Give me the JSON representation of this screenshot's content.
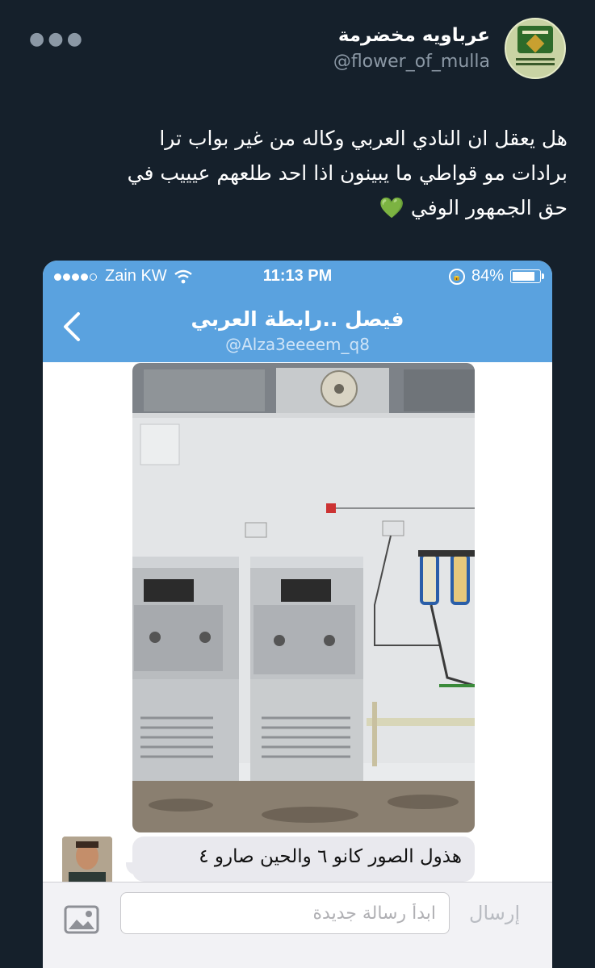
{
  "tweet": {
    "display_name": "عرباويه مخضرمة",
    "handle": "@flower_of_mulla",
    "text_lines": [
      "هل يعقل ان النادي العربي وكاله من غير بواب ترا",
      "برادات  مو قواطي ما يبينون اذا احد طلعهم عيييب في",
      "حق الجمهور الوفي"
    ],
    "emoji": "💚",
    "more_icon": "more-dots-icon"
  },
  "screenshot": {
    "status_bar": {
      "carrier": "Zain KW",
      "time": "11:13 PM",
      "battery": "84%"
    },
    "nav": {
      "title": "فيصل ..رابطة العربي",
      "subtitle": "@Alza3eeeem_q8"
    },
    "message": {
      "text": "هذول الصور كانو ٦ والحين صارو ٤"
    },
    "composer": {
      "placeholder": "ابدأ رسالة جديدة",
      "send_label": "إرسال"
    }
  },
  "colors": {
    "background": "#15202b",
    "ios_blue": "#5aa2df",
    "heart": "#7ed957"
  }
}
